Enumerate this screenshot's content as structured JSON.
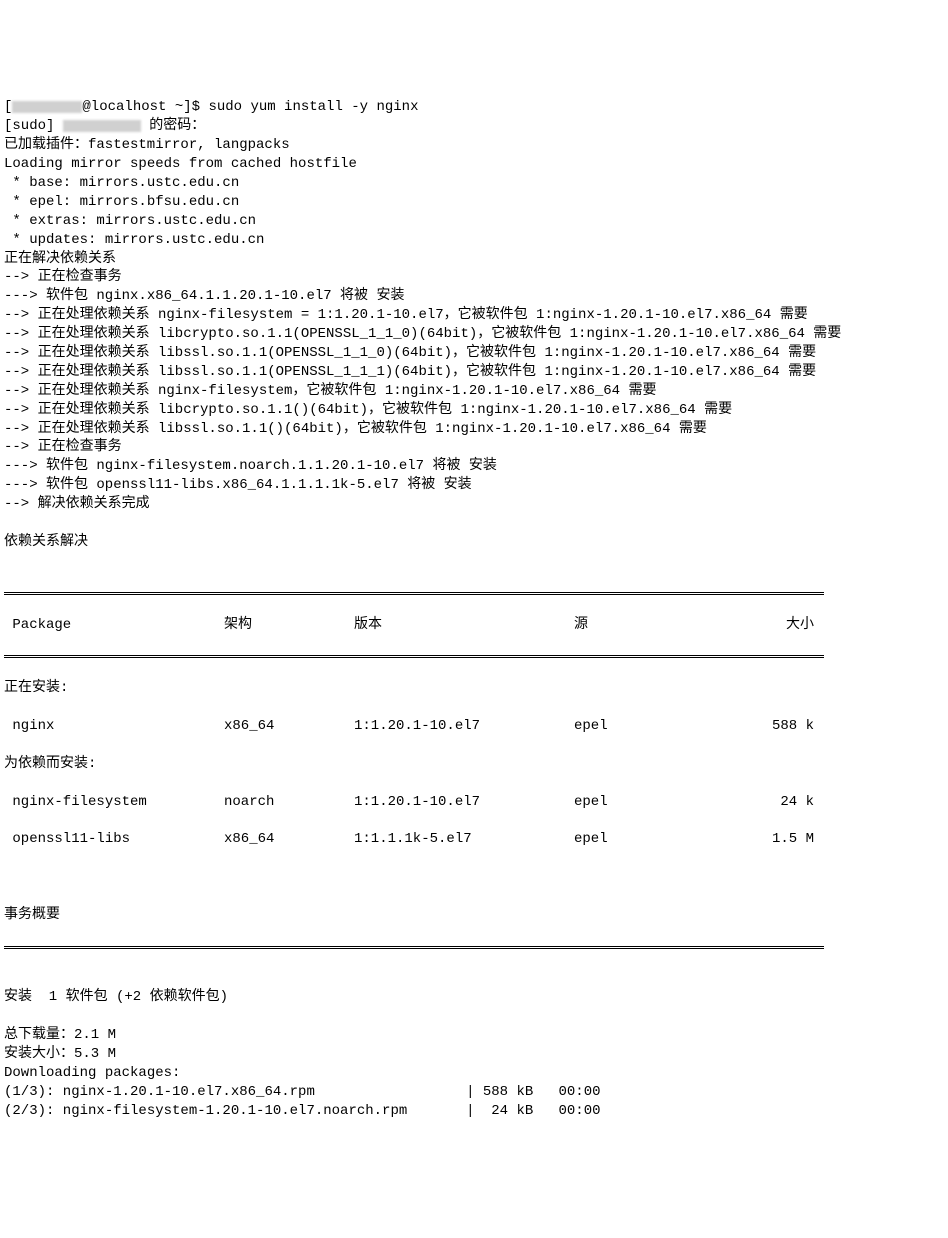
{
  "prompt": {
    "open_bracket": "[",
    "host_suffix": "@localhost ~]$ ",
    "command": "sudo yum install -y nginx"
  },
  "sudo_line": {
    "prefix": "[sudo] ",
    "suffix": " 的密码："
  },
  "pre_lines": [
    "已加载插件：fastestmirror, langpacks",
    "Loading mirror speeds from cached hostfile",
    " * base: mirrors.ustc.edu.cn",
    " * epel: mirrors.bfsu.edu.cn",
    " * extras: mirrors.ustc.edu.cn",
    " * updates: mirrors.ustc.edu.cn",
    "正在解决依赖关系",
    "--> 正在检查事务",
    "---> 软件包 nginx.x86_64.1.1.20.1-10.el7 将被 安装",
    "--> 正在处理依赖关系 nginx-filesystem = 1:1.20.1-10.el7，它被软件包 1:nginx-1.20.1-10.el7.x86_64 需要",
    "--> 正在处理依赖关系 libcrypto.so.1.1(OPENSSL_1_1_0)(64bit)，它被软件包 1:nginx-1.20.1-10.el7.x86_64 需要",
    "--> 正在处理依赖关系 libssl.so.1.1(OPENSSL_1_1_0)(64bit)，它被软件包 1:nginx-1.20.1-10.el7.x86_64 需要",
    "--> 正在处理依赖关系 libssl.so.1.1(OPENSSL_1_1_1)(64bit)，它被软件包 1:nginx-1.20.1-10.el7.x86_64 需要",
    "--> 正在处理依赖关系 nginx-filesystem，它被软件包 1:nginx-1.20.1-10.el7.x86_64 需要",
    "--> 正在处理依赖关系 libcrypto.so.1.1()(64bit)，它被软件包 1:nginx-1.20.1-10.el7.x86_64 需要",
    "--> 正在处理依赖关系 libssl.so.1.1()(64bit)，它被软件包 1:nginx-1.20.1-10.el7.x86_64 需要",
    "--> 正在检查事务",
    "---> 软件包 nginx-filesystem.noarch.1.1.20.1-10.el7 将被 安装",
    "---> 软件包 openssl11-libs.x86_64.1.1.1.1k-5.el7 将被 安装",
    "--> 解决依赖关系完成",
    "",
    "依赖关系解决",
    ""
  ],
  "table": {
    "headers": {
      "package": " Package",
      "arch": "架构",
      "version": "版本",
      "repo": "源",
      "size": "大小"
    },
    "section_installing": "正在安装:",
    "section_deps": "为依赖而安装:",
    "rows_install": [
      {
        "name": " nginx",
        "arch": "x86_64",
        "version": "1:1.20.1-10.el7",
        "repo": "epel",
        "size": "588 k"
      }
    ],
    "rows_deps": [
      {
        "name": " nginx-filesystem",
        "arch": "noarch",
        "version": "1:1.20.1-10.el7",
        "repo": "epel",
        "size": "24 k"
      },
      {
        "name": " openssl11-libs",
        "arch": "x86_64",
        "version": "1:1.1.1k-5.el7",
        "repo": "epel",
        "size": "1.5 M"
      }
    ]
  },
  "summary_header": "事务概要",
  "summary_lines": [
    "安装  1 软件包 (+2 依赖软件包)",
    "",
    "总下载量：2.1 M",
    "安装大小：5.3 M",
    "Downloading packages:"
  ],
  "downloads": [
    {
      "label": "(1/3): nginx-1.20.1-10.el7.x86_64.rpm",
      "size": "588 kB",
      "time": "00:00"
    },
    {
      "label": "(2/3): nginx-filesystem-1.20.1-10.el7.noarch.rpm",
      "size": " 24 kB",
      "time": "00:00"
    }
  ]
}
